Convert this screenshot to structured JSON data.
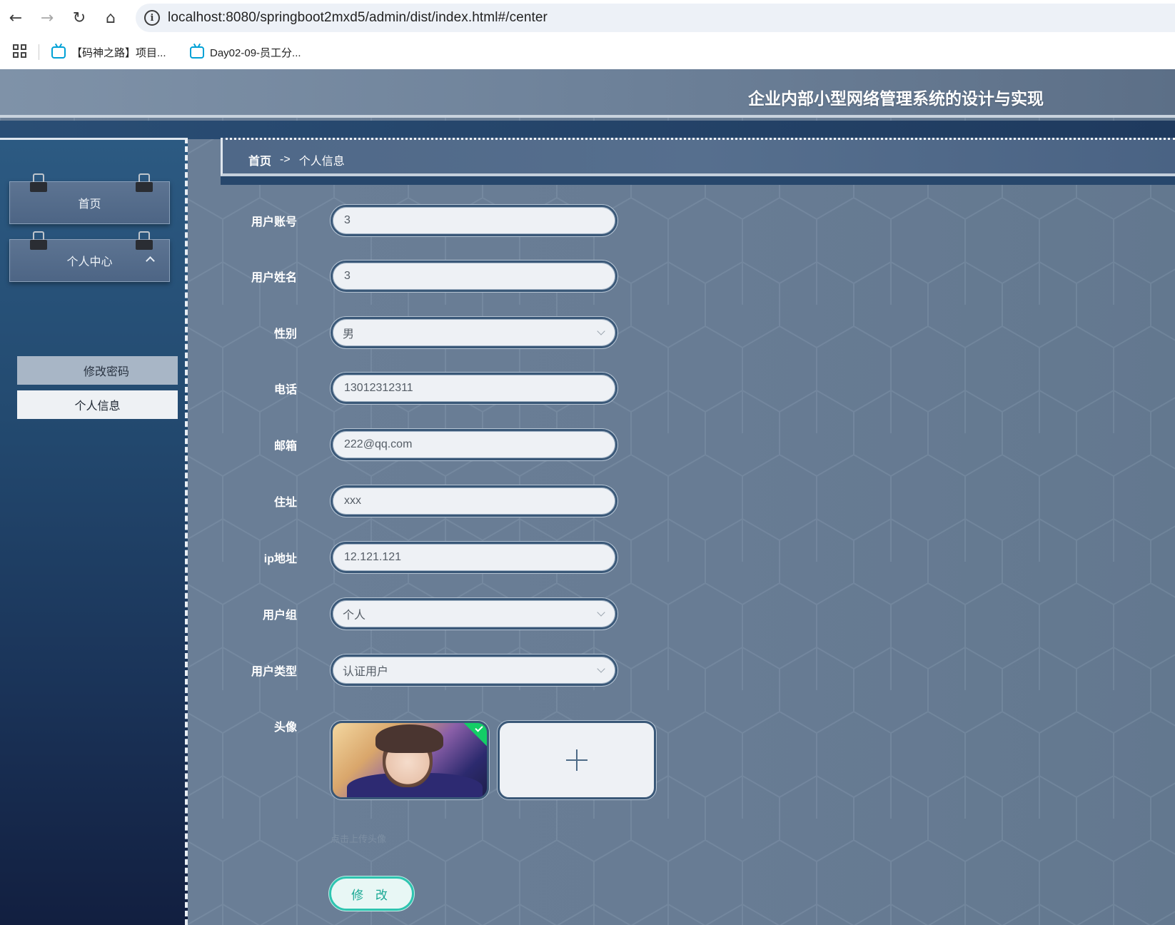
{
  "browser": {
    "url": "localhost:8080/springboot2mxd5/admin/dist/index.html#/center",
    "nav": {
      "back": "←",
      "forward": "→",
      "reload": "↻",
      "home": "⌂"
    },
    "bookmarks": [
      {
        "label": "【码神之路】项目..."
      },
      {
        "label": "Day02-09-员工分..."
      }
    ]
  },
  "app": {
    "title": "企业内部小型网络管理系统的设计与实现"
  },
  "sidebar": {
    "home": "首页",
    "center": "个人中心",
    "sub_items": [
      {
        "label": "修改密码"
      },
      {
        "label": "个人信息"
      }
    ]
  },
  "breadcrumb": {
    "home": "首页",
    "separator": "->",
    "current": "个人信息"
  },
  "form": {
    "fields": [
      {
        "label": "用户账号",
        "value": "3"
      },
      {
        "label": "用户姓名",
        "value": "3"
      },
      {
        "label": "性别",
        "value": "男"
      },
      {
        "label": "电话",
        "value": "13012312311"
      },
      {
        "label": "邮箱",
        "value": "222@qq.com"
      },
      {
        "label": "住址",
        "value": "xxx"
      },
      {
        "label": "ip地址",
        "value": "12.121.121"
      },
      {
        "label": "用户组",
        "value": "个人"
      },
      {
        "label": "用户类型",
        "value": "认证用户"
      }
    ],
    "avatar_label": "头像",
    "upload_tip": "点击上传头像",
    "submit": "修 改"
  },
  "colors": {
    "accent": "#2ec4b0",
    "sidebar": "#234a70",
    "upload_success": "#13ce66"
  }
}
